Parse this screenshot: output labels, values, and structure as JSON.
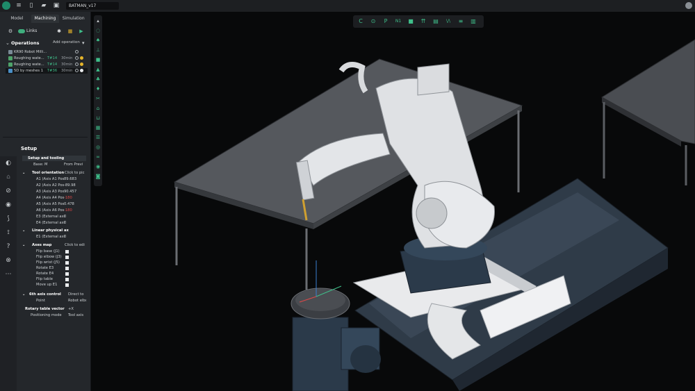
{
  "app": {
    "file_name": "BATMAN_v17"
  },
  "left_panel": {
    "tabs": [
      "Model",
      "Machining",
      "Simulation"
    ],
    "links_label": "Links",
    "operations_title": "Operations",
    "add_operation_label": "Add operation",
    "operations": [
      {
        "label": "KR90 Robot Milli...",
        "tool": "",
        "time": ""
      },
      {
        "label": "Roughing wate...",
        "tool": "T#14",
        "time": "30min"
      },
      {
        "label": "Roughing wate...",
        "tool": "T#14",
        "time": "30min"
      },
      {
        "label": "5D by meshes 1",
        "tool": "T#36",
        "time": "30min"
      }
    ]
  },
  "setup": {
    "title": "Setup",
    "setup_and_tooling": "Setup and tooling",
    "base": {
      "label": "Base: M",
      "value": "From Previ"
    },
    "tool_orientation": {
      "label": "Tool orientation",
      "value": "Click to pic"
    },
    "axes": [
      {
        "label": "A1 (Axis A1 Pos",
        "value": "89.683",
        "red": false
      },
      {
        "label": "A2 (Axis A2 Pos",
        "value": "-89.98",
        "red": false
      },
      {
        "label": "A3 (Axis A3 Pos",
        "value": "90.457",
        "red": false
      },
      {
        "label": "A4 (Axis A4 Pos",
        "value": "-180",
        "red": true
      },
      {
        "label": "A5 (Axis A5 Pos",
        "value": "0.478",
        "red": false
      },
      {
        "label": "A6 (Axis A6 Pos",
        "value": "-180",
        "red": true
      },
      {
        "label": "E3 (External axi",
        "value": "0",
        "red": false
      },
      {
        "label": "E4 (External axi",
        "value": "0",
        "red": false
      }
    ],
    "linear_physical": {
      "label": "Linear physical ax"
    },
    "e1": {
      "label": "E1 (External axi",
      "value": "0"
    },
    "axes_map": {
      "label": "Axes map",
      "value": "Click to edi"
    },
    "flips": [
      "Flip base (J1)",
      "Flip elbow (J3)",
      "Flip wrist (J5)",
      "Rotate E3",
      "Rotate E4",
      "Flip table",
      "Move up E1"
    ],
    "sixth_axis": {
      "label": "6th axis control",
      "value": "Direct to"
    },
    "point": {
      "label": "Point",
      "value": "Robot elbow"
    },
    "rotary_vector": {
      "label": "Rotary table vector",
      "value": "+X"
    },
    "positioning_mode": {
      "label": "Positioning mode",
      "value": "Tool axis"
    }
  },
  "toolbar_top": {
    "items": [
      "C",
      "⊙",
      "P",
      "N1",
      "■",
      "⇈",
      "▤",
      "\\/\\",
      "≡",
      "▥"
    ]
  },
  "colors": {
    "accent": "#3fbf8a",
    "warning": "#e6b52a",
    "error": "#e04848",
    "panel_bg": "#24272b",
    "viewport_bg": "#08090a"
  }
}
